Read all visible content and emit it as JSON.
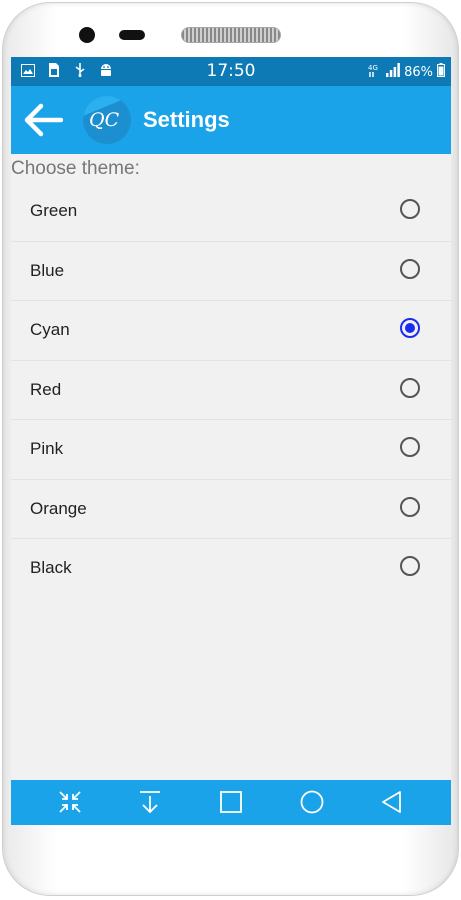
{
  "status_bar": {
    "time": "17:50",
    "battery": "86%",
    "left_icons": [
      "image-icon",
      "sim-icon",
      "usb-icon",
      "android-icon"
    ],
    "right_icons": [
      "network-4g-icon",
      "signal-icon",
      "battery-icon"
    ]
  },
  "action_bar": {
    "title": "Settings",
    "back_icon": "arrow-left-icon",
    "logo_text": "QC"
  },
  "prompt": "Choose theme:",
  "themes": [
    {
      "label": "Green",
      "selected": false
    },
    {
      "label": "Blue",
      "selected": false
    },
    {
      "label": "Cyan",
      "selected": true
    },
    {
      "label": "Red",
      "selected": false
    },
    {
      "label": "Pink",
      "selected": false
    },
    {
      "label": "Orange",
      "selected": false
    },
    {
      "label": "Black",
      "selected": false
    }
  ],
  "nav_bar": [
    "collapse-icon",
    "download-icon",
    "recents-icon",
    "home-icon",
    "back-icon"
  ],
  "colors": {
    "status_bar": "#0d7ab5",
    "accent": "#1aa3e8",
    "radio_selected": "#1a2cf0",
    "background": "#f1f1f1"
  }
}
